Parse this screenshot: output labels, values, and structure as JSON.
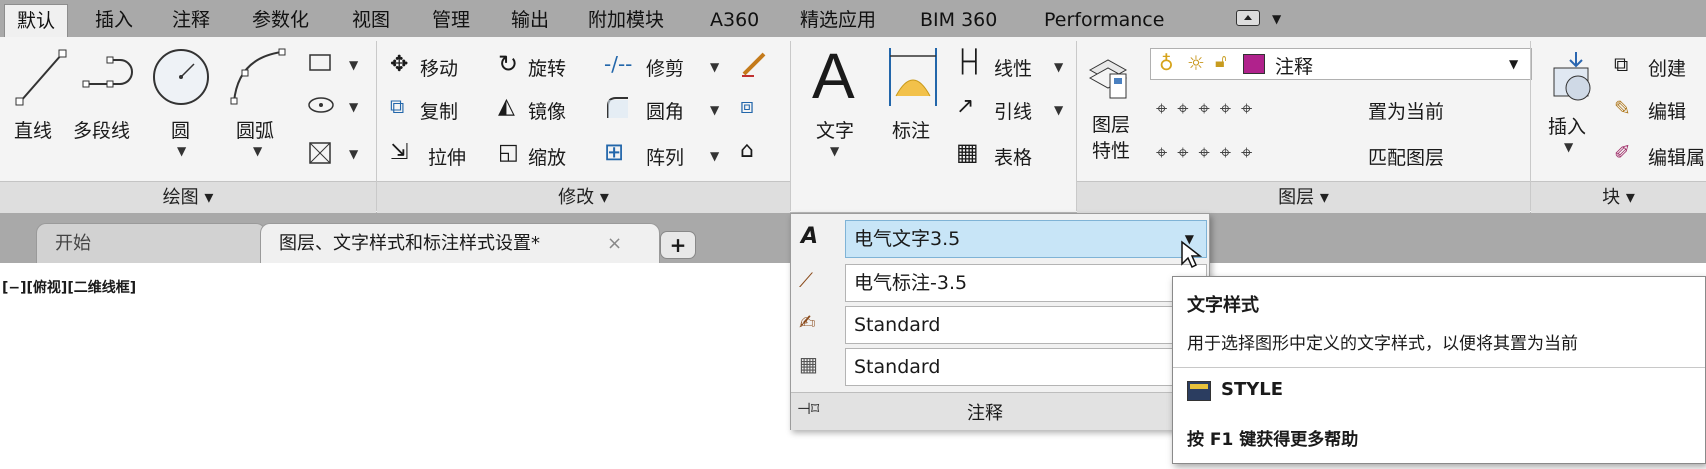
{
  "menu": {
    "tabs": [
      "默认",
      "插入",
      "注释",
      "参数化",
      "视图",
      "管理",
      "输出",
      "附加模块",
      "A360",
      "精选应用",
      "BIM 360",
      "Performance"
    ]
  },
  "draw_panel": {
    "title": "绘图 ▾",
    "tools": [
      "直线",
      "多段线",
      "圆",
      "圆弧"
    ]
  },
  "modify_panel": {
    "title": "修改 ▾",
    "tools": [
      "移动",
      "旋转",
      "修剪",
      "复制",
      "镜像",
      "圆角",
      "拉伸",
      "缩放",
      "阵列"
    ]
  },
  "annotation_panel": {
    "text": "文字",
    "dimension": "标注",
    "linear": "线性",
    "leader": "引线",
    "table": "表格"
  },
  "layers_panel": {
    "title": "图层 ▾",
    "layer_props": "图层\n特性",
    "current_layer": "注释",
    "set_current": "置为当前",
    "match_layer": "匹配图层",
    "layer_color": "#b0228c"
  },
  "block_panel": {
    "title": "块 ▾",
    "insert": "插入",
    "create": "创建",
    "edit": "编辑",
    "edit_attr": "编辑属"
  },
  "doc_tabs": {
    "start": "开始",
    "current": "图层、文字样式和标注样式设置*",
    "close": "×",
    "add": "+"
  },
  "viewport_label": "[−][俯视][二维线框]",
  "annotation_dropdown": {
    "text_style": "电气文字3.5",
    "dim_style": "电气标注-3.5",
    "mleader_style": "Standard",
    "table_style": "Standard",
    "footer": "注释"
  },
  "tooltip": {
    "title": "文字样式",
    "description": "用于选择图形中定义的文字样式，以便将其置为当前",
    "command": "STYLE",
    "help": "按 F1 键获得更多帮助"
  }
}
